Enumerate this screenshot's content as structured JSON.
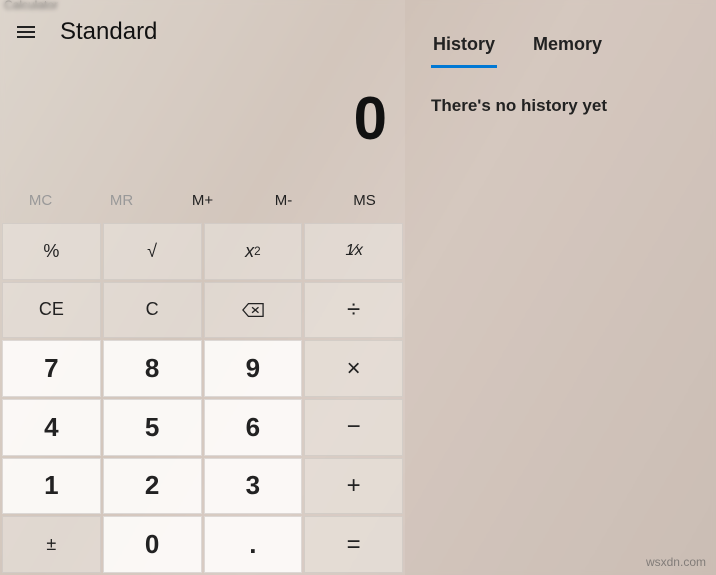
{
  "window": {
    "title": "Calculator"
  },
  "mode": {
    "title": "Standard"
  },
  "display": {
    "value": "0"
  },
  "memory": {
    "mc": "MC",
    "mr": "MR",
    "mplus": "M+",
    "mminus": "M-",
    "ms": "MS"
  },
  "keys": {
    "percent": "%",
    "sqrt": "√",
    "square_base": "x",
    "square_exp": "2",
    "reciprocal_num": "1",
    "reciprocal_sep": "⁄",
    "reciprocal_den": "x",
    "ce": "CE",
    "c": "C",
    "divide": "÷",
    "n7": "7",
    "n8": "8",
    "n9": "9",
    "multiply": "×",
    "n4": "4",
    "n5": "5",
    "n6": "6",
    "minus": "−",
    "n1": "1",
    "n2": "2",
    "n3": "3",
    "plus": "+",
    "negate": "±",
    "n0": "0",
    "dot": ".",
    "equals": "="
  },
  "tabs": {
    "history": "History",
    "memory": "Memory",
    "active": "history"
  },
  "history": {
    "empty_msg": "There's no history yet"
  },
  "watermark": "wsxdn.com"
}
